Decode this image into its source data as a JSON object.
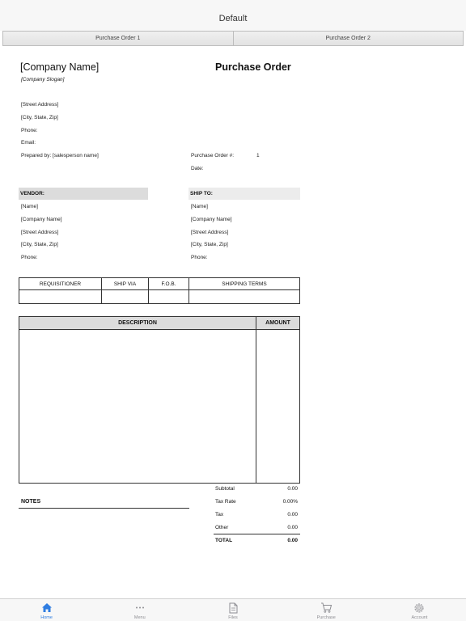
{
  "nav": {
    "title": "Default"
  },
  "tabs": [
    "Purchase Order 1",
    "Purchase Order 2"
  ],
  "header": {
    "company_name": "[Company Name]",
    "slogan": "[Company Slogan]",
    "title": "Purchase Order"
  },
  "address": {
    "street": "[Street Address]",
    "city": "[City, State,  Zip]",
    "phone": "Phone:",
    "email": "Email:",
    "prepared_by": "Prepared by: [salesperson name]"
  },
  "po": {
    "number_label": "Purchase Order #:",
    "number_value": "1",
    "date_label": "Date:"
  },
  "vendor": {
    "header": "VENDOR:",
    "name": "[Name]",
    "company": "[Company Name]",
    "street": "[Street Address]",
    "city": "[City, State,  Zip]",
    "phone": "Phone:"
  },
  "ship_to": {
    "header": "SHIP TO:",
    "name": "[Name]",
    "company": "[Company Name]",
    "street": "[Street Address]",
    "city": "[City, State,  Zip]",
    "phone": "Phone:"
  },
  "req_table": {
    "columns": [
      "REQUISITIONER",
      "SHIP VIA",
      "F.O.B.",
      "SHIPPING TERMS"
    ]
  },
  "items_table": {
    "description_header": "DESCRIPTION",
    "amount_header": "AMOUNT"
  },
  "totals": {
    "subtotal_label": "Subtotal",
    "subtotal_value": "0.00",
    "tax_rate_label": "Tax Rate",
    "tax_rate_value": "0.00%",
    "tax_label": "Tax",
    "tax_value": "0.00",
    "other_label": "Other",
    "other_value": "0.00",
    "total_label": "TOTAL",
    "total_value": "0.00"
  },
  "notes": {
    "label": "NOTES"
  },
  "tabbar": {
    "items": [
      {
        "label": "Home",
        "icon": "home-icon",
        "active": true
      },
      {
        "label": "Menu",
        "icon": "more-icon"
      },
      {
        "label": "Files",
        "icon": "file-icon"
      },
      {
        "label": "Purchase",
        "icon": "cart-icon"
      },
      {
        "label": "Account",
        "icon": "gear-icon"
      }
    ],
    "active_color": "#2f7de1",
    "inactive_color": "#8e8e93"
  }
}
